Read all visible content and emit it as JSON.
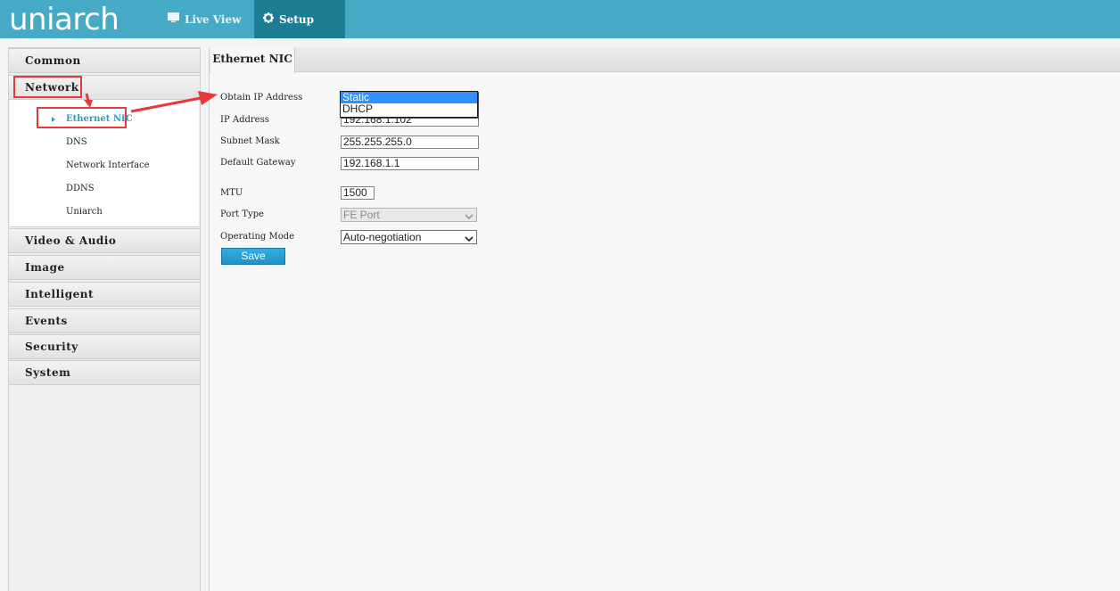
{
  "header": {
    "logo": "uniarch",
    "tabs": [
      {
        "label": "Live View",
        "icon": "monitor-icon"
      },
      {
        "label": "Setup",
        "icon": "gear-icon",
        "active": true
      }
    ]
  },
  "sidebar": {
    "menus": [
      "Common",
      "Network",
      "Video & Audio",
      "Image",
      "Intelligent",
      "Events",
      "Security",
      "System"
    ],
    "network_submenu": [
      "Ethernet NIC",
      "DNS",
      "Network Interface",
      "DDNS",
      "Uniarch"
    ],
    "active_submenu": "Ethernet NIC"
  },
  "content": {
    "tab": "Ethernet NIC",
    "labels": {
      "obtain_ip": "Obtain IP Address",
      "ip_address": "IP Address",
      "subnet_mask": "Subnet Mask",
      "default_gateway": "Default Gateway",
      "mtu": "MTU",
      "port_type": "Port Type",
      "operating_mode": "Operating Mode"
    },
    "values": {
      "ip_address": "192.168.1.102",
      "subnet_mask": "255.255.255.0",
      "default_gateway": "192.168.1.1",
      "mtu": "1500",
      "port_type": "FE Port",
      "operating_mode": "Auto-negotiation"
    },
    "obtain_ip_options": [
      "Static",
      "DHCP"
    ],
    "obtain_ip_selected": "Static",
    "save_label": "Save"
  },
  "colors": {
    "header": "#46aac6",
    "setup_tab": "#1d7d94",
    "accent": "#2f9ec0",
    "annotation": "#e8383b"
  }
}
